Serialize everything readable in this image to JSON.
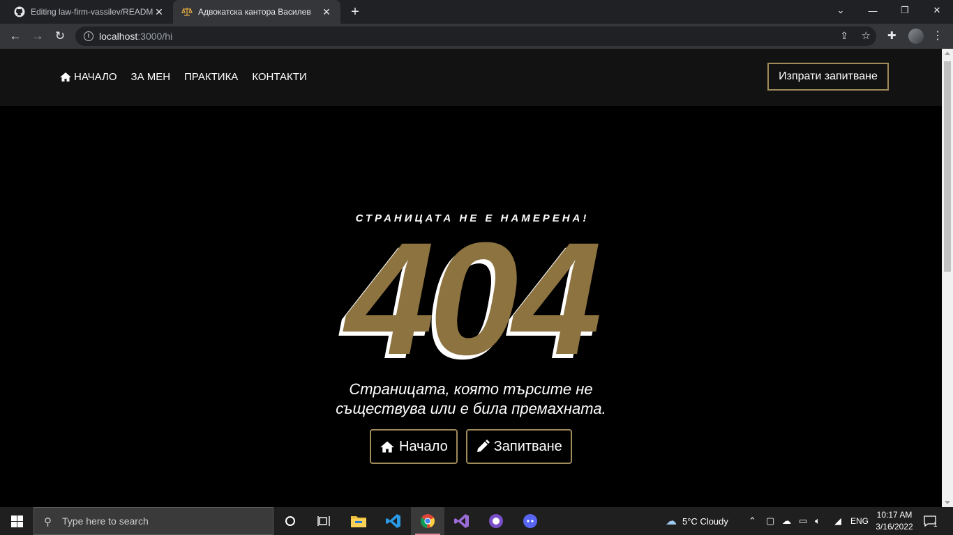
{
  "browser": {
    "tabs": [
      {
        "title": "Editing law-firm-vassilev/READM"
      },
      {
        "title": "Адвокатска кантора Василев"
      }
    ],
    "url_host": "localhost",
    "url_path": ":3000/hi"
  },
  "site": {
    "nav": [
      "НАЧАЛО",
      "ЗА МЕН",
      "ПРАКТИКА",
      "КОНТАКТИ"
    ],
    "inquire_button": "Изпрати запитване",
    "subtitle": "СТРАНИЦАТА НЕ Е НАМЕРЕНА!",
    "code": "404",
    "message_line1": "Страницата, която търсите не",
    "message_line2": "съществува или е била премахната.",
    "home_button": "Начало",
    "inquiry_button": "Запитване",
    "accent_color": "#a08b5a",
    "code_color": "#8c7340"
  },
  "taskbar": {
    "search_placeholder": "Type here to search",
    "weather": "5°C  Cloudy",
    "language": "ENG",
    "time": "10:17 AM",
    "date": "3/16/2022",
    "notifications": "1"
  }
}
